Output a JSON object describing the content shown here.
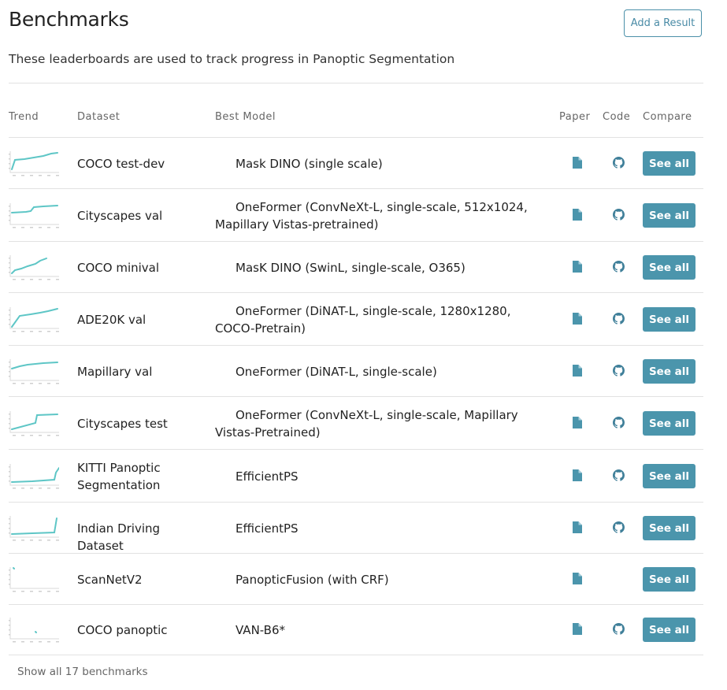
{
  "page": {
    "title": "Benchmarks",
    "add_button": "Add a Result",
    "subtitle": "These leaderboards are used to track progress in Panoptic Segmentation"
  },
  "table": {
    "columns": {
      "trend": "Trend",
      "dataset": "Dataset",
      "best_model": "Best Model",
      "paper": "Paper",
      "code": "Code",
      "compare": "Compare"
    },
    "accent_color": "#4b95ac",
    "trend_color": "#5ec6c6",
    "rows": [
      {
        "dataset": "COCO test-dev",
        "model": "Mask DINO (single scale)",
        "has_paper": true,
        "has_code": true,
        "compare": "See all",
        "trend_icon": "line-trend-chart"
      },
      {
        "dataset": "Cityscapes val",
        "model": "OneFormer (ConvNeXt-L, single-scale, 512x1024, Mapillary Vistas-pretrained)",
        "has_paper": true,
        "has_code": true,
        "compare": "See all",
        "trend_icon": "line-trend-chart"
      },
      {
        "dataset": "COCO minival",
        "model": "MasK DINO (SwinL, single-scale, O365)",
        "has_paper": true,
        "has_code": true,
        "compare": "See all",
        "trend_icon": "line-trend-chart"
      },
      {
        "dataset": "ADE20K val",
        "model": "OneFormer (DiNAT-L, single-scale, 1280x1280, COCO-Pretrain)",
        "has_paper": true,
        "has_code": true,
        "compare": "See all",
        "trend_icon": "line-trend-chart"
      },
      {
        "dataset": "Mapillary val",
        "model": "OneFormer (DiNAT-L, single-scale)",
        "has_paper": true,
        "has_code": true,
        "compare": "See all",
        "trend_icon": "line-trend-chart"
      },
      {
        "dataset": "Cityscapes test",
        "model": "OneFormer (ConvNeXt-L, single-scale, Mapillary Vistas-Pretrained)",
        "has_paper": true,
        "has_code": true,
        "compare": "See all",
        "trend_icon": "line-trend-chart"
      },
      {
        "dataset": "KITTI Panoptic Segmentation",
        "model": "EfficientPS",
        "has_paper": true,
        "has_code": true,
        "compare": "See all",
        "trend_icon": "line-trend-chart"
      },
      {
        "dataset": "Indian Driving Dataset",
        "model": "EfficientPS",
        "has_paper": true,
        "has_code": true,
        "compare": "See all",
        "trend_icon": "line-trend-chart"
      },
      {
        "dataset": "ScanNetV2",
        "model": "PanopticFusion (with CRF)",
        "has_paper": true,
        "has_code": false,
        "compare": "See all",
        "trend_icon": "line-trend-chart"
      },
      {
        "dataset": "COCO panoptic",
        "model": "VAN-B6*",
        "has_paper": true,
        "has_code": true,
        "compare": "See all",
        "trend_icon": "line-trend-chart"
      }
    ]
  },
  "footer": {
    "show_all": "Show all 17 benchmarks"
  }
}
